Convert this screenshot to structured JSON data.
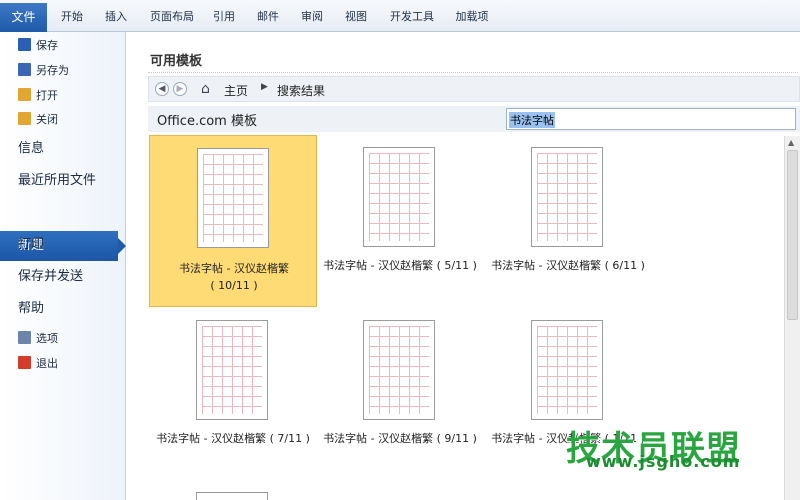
{
  "ribbon": {
    "tabs": [
      "文件",
      "开始",
      "插入",
      "页面布局",
      "引用",
      "邮件",
      "审阅",
      "视图",
      "开发工具",
      "加载项"
    ]
  },
  "backstage": {
    "quick_commands": [
      {
        "label": "保存",
        "icon": "save-icon",
        "color": "#2b5fb3"
      },
      {
        "label": "另存为",
        "icon": "save-as-icon",
        "color": "#3a66b5"
      },
      {
        "label": "打开",
        "icon": "open-folder-icon",
        "color": "#e0a830"
      },
      {
        "label": "关闭",
        "icon": "close-folder-icon",
        "color": "#e0a830"
      }
    ],
    "sections": [
      "信息",
      "最近所用文件",
      "新建",
      "打印",
      "保存并发送",
      "帮助"
    ],
    "selected_section": "新建",
    "bottom_commands": [
      {
        "label": "选项",
        "icon": "options-icon",
        "color": "#6b86a8"
      },
      {
        "label": "退出",
        "icon": "exit-icon",
        "color": "#d43b2a"
      }
    ]
  },
  "main": {
    "title": "可用模板",
    "breadcrumb": {
      "home": "主页",
      "current": "搜索结果"
    },
    "source_label": "Office.com 模板",
    "search_value": "书法字帖",
    "templates": [
      {
        "line1": "书法字帖 - 汉仪赵楷繁",
        "line2": "( 10/11 )",
        "selected": true
      },
      {
        "line1": "书法字帖 - 汉仪赵楷繁 ( 5/11 )",
        "line2": "",
        "selected": false
      },
      {
        "line1": "书法字帖 - 汉仪赵楷繁 ( 6/11 )",
        "line2": "",
        "selected": false
      },
      {
        "line1": "书法字帖 - 汉仪赵楷繁 ( 7/11 )",
        "line2": "",
        "selected": false
      },
      {
        "line1": "书法字帖 - 汉仪赵楷繁 ( 9/11 )",
        "line2": "",
        "selected": false
      },
      {
        "line1": "书法字帖 - 汉仪赵楷繁 ( 1/11 )",
        "line2": "",
        "selected": false
      }
    ]
  },
  "watermark": {
    "text": "技术员联盟",
    "url": "www.jsgho.com"
  },
  "colors": {
    "accent": "#1f5aa8",
    "selected_card": "#ffdb75",
    "grid_line": "#e9b9bf",
    "watermark": "#2aa640"
  }
}
